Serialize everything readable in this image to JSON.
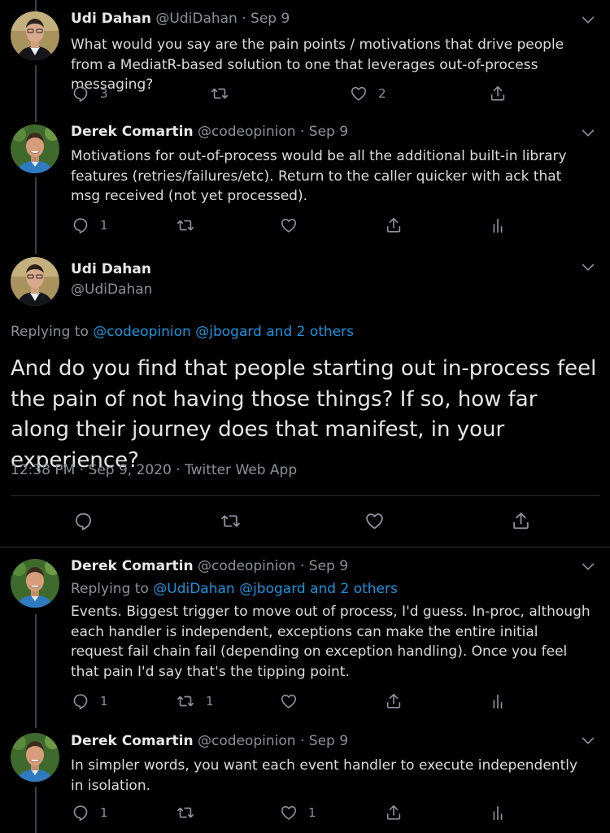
{
  "tweets": [
    {
      "name": "Udi Dahan",
      "handle": "@UdiDahan",
      "date": "Sep 9",
      "text": "What would you say are the pain points / motivations that drive people from a MediatR-based solution to one that leverages out-of-process messaging?",
      "reply_count": "3",
      "retweet_count": "",
      "like_count": "2"
    },
    {
      "name": "Derek Comartin",
      "handle": "@codeopinion",
      "date": "Sep 9",
      "text": "Motivations for out-of-process would be all the additional built-in library features (retries/failures/etc). Return to the caller quicker with ack that msg received (not yet processed).",
      "reply_count": "1",
      "retweet_count": "",
      "like_count": ""
    },
    {
      "name": "Derek Comartin",
      "handle": "@codeopinion",
      "date": "Sep 9",
      "replying_prefix": "Replying to",
      "replying_links": "@UdiDahan @jbogard and 2 others",
      "text": "Events. Biggest trigger to move out of process, I'd guess. In-proc, although each handler is independent, exceptions can make the entire initial request fail chain fail (depending on exception handling). Once you feel that pain I'd say that's the tipping point.",
      "reply_count": "1",
      "retweet_count": "1",
      "like_count": ""
    },
    {
      "name": "Derek Comartin",
      "handle": "@codeopinion",
      "date": "Sep 9",
      "text": "In simpler words, you want each event handler to execute independently in isolation.",
      "reply_count": "1",
      "retweet_count": "",
      "like_count": "1"
    }
  ],
  "main_tweet": {
    "name": "Udi Dahan",
    "handle": "@UdiDahan",
    "replying_prefix": "Replying to",
    "replying_links": "@codeopinion @jbogard and 2 others",
    "text": "And do you find that people starting out in-process feel the pain of not having those things? If so, how far along their journey does that manifest, in your experience?",
    "timestamp": "12:38 PM · Sep 9, 2020 · Twitter Web App"
  },
  "separator": "·",
  "icons": [
    "reply-icon",
    "retweet-icon",
    "like-icon",
    "share-icon",
    "analytics-icon",
    "chevron-down-icon"
  ],
  "colors": {
    "background": "#000000",
    "link": "#1b95e0",
    "muted": "#8b9299",
    "text": "#d9d9d9"
  }
}
